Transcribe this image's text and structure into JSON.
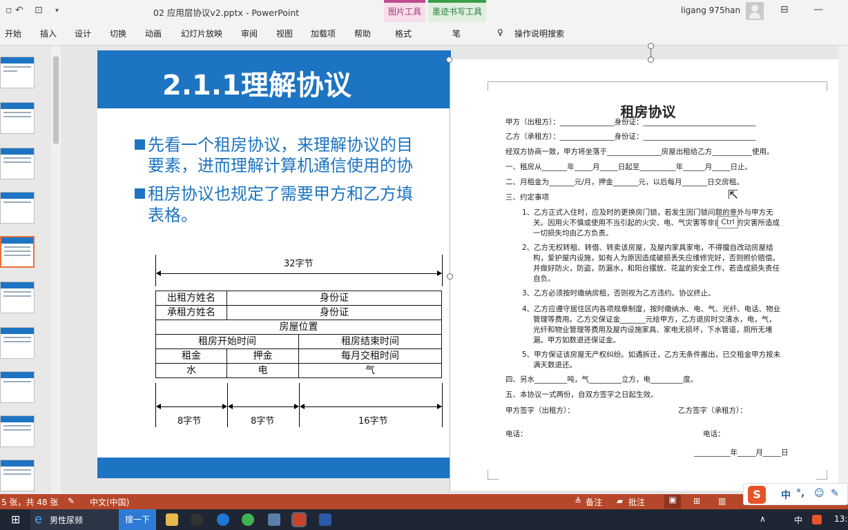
{
  "window": {
    "doc_title": "02 应用层协议v2.pptx  -  PowerPoint",
    "user_name": "ligang 975han",
    "context_tabs": [
      {
        "group": "图片工具",
        "tab": "格式",
        "color": "#c04b8e"
      },
      {
        "group": "墨迹书写工具",
        "tab": "笔",
        "color": "#3a9e4a"
      }
    ]
  },
  "ribbon": {
    "tabs": [
      "开始",
      "插入",
      "设计",
      "切换",
      "动画",
      "幻灯片放映",
      "审阅",
      "视图",
      "加载项",
      "帮助"
    ],
    "tell_me": "操作说明搜索"
  },
  "slide": {
    "title": "2.1.1理解协议",
    "bullets": [
      [
        "先看一个租房协议，来理解协议的目",
        "要素，进而理解计算机通信使用的协"
      ],
      [
        "租房协议也规定了需要甲方和乙方填",
        "表格。"
      ]
    ],
    "byte_table": {
      "total_label": "32字节",
      "rows": [
        [
          "出租方姓名",
          "身份证"
        ],
        [
          "承租方姓名",
          "身份证"
        ],
        [
          "房屋位置"
        ],
        [
          "租房开始时间",
          "租房结束时间"
        ],
        [
          "租金",
          "押金",
          "每月交租时间"
        ],
        [
          "水",
          "电",
          "气"
        ]
      ],
      "bottom_labels": [
        "8字节",
        "8字节",
        "16字节"
      ]
    }
  },
  "document": {
    "title": "租房协议",
    "lines": [
      "甲方（出租方）：_______________身份证：_______________________________",
      "乙方（承租方）：_______________身份证：_______________________________",
      "经双方协商一致，甲方将坐落于_______________房屋出租给乙方___________使用。",
      "一、租房从_______年_____月_____日起至__________年______月_____日止。",
      "二、月租金为_______元/月，押金_______元，以后每月_______日交房租。",
      "三、约定事项",
      "1、乙方正式入住时，应及时的更换房门锁，若发生因门锁问题的意外与甲方无",
      "关。因用火不慎或使用不当引起的火灾、电、气灾害等非自然类的灾害所造成",
      "一切损失均由乙方负责。",
      "2、乙方无权转租、转借、转卖该房屋，及屋内家具家电，不得擅自改动房屋结",
      "构，爱护屋内设施，如有人为原因造成破损丢失应维修完好，否则照价赔偿。",
      "并做好防火，防盗，防漏水，和阳台摆放、花盆的安全工作，若造成损失责任",
      "自负。",
      "3、乙方必须按时缴纳房租，否则视为乙方违约。协议终止。",
      "4、乙方应遵守居住区内各项规章制度，按时缴纳水、电、气、光纤、电话、物业",
      "管理等费用。乙方交保证金_______元给甲方，乙方退房时交清水，电，气，",
      "光纤和物业管理等费用及屋内设施家具、家电无损坏，下水管道，厕所无堵",
      "漏。甲方如数退还保证金。",
      "5、甲方保证该房屋无产权纠纷。如遇拆迁，乙方无条件搬出，已交租金甲方按未",
      "满天数退还。",
      "四、另水_________吨，气_________立方，电_________度。",
      "五、本协议一式两份，自双方签字之日起生效。",
      "甲方签字（出租方）：",
      "乙方签字（承租方）：",
      "电话：",
      "电话：",
      "__________年_____月_____日"
    ],
    "tooltip": "Ctrl"
  },
  "status": {
    "slide_info": "5 张，共 48 张",
    "language": "中文(中国)",
    "notes": "备注",
    "comments": "批注"
  },
  "ime": {
    "mode": "中",
    "punct": "°,"
  },
  "taskbar": {
    "browser_label": "男性尿频",
    "search_label": "搜一下",
    "tray_lang": "中",
    "clock": "13:"
  }
}
